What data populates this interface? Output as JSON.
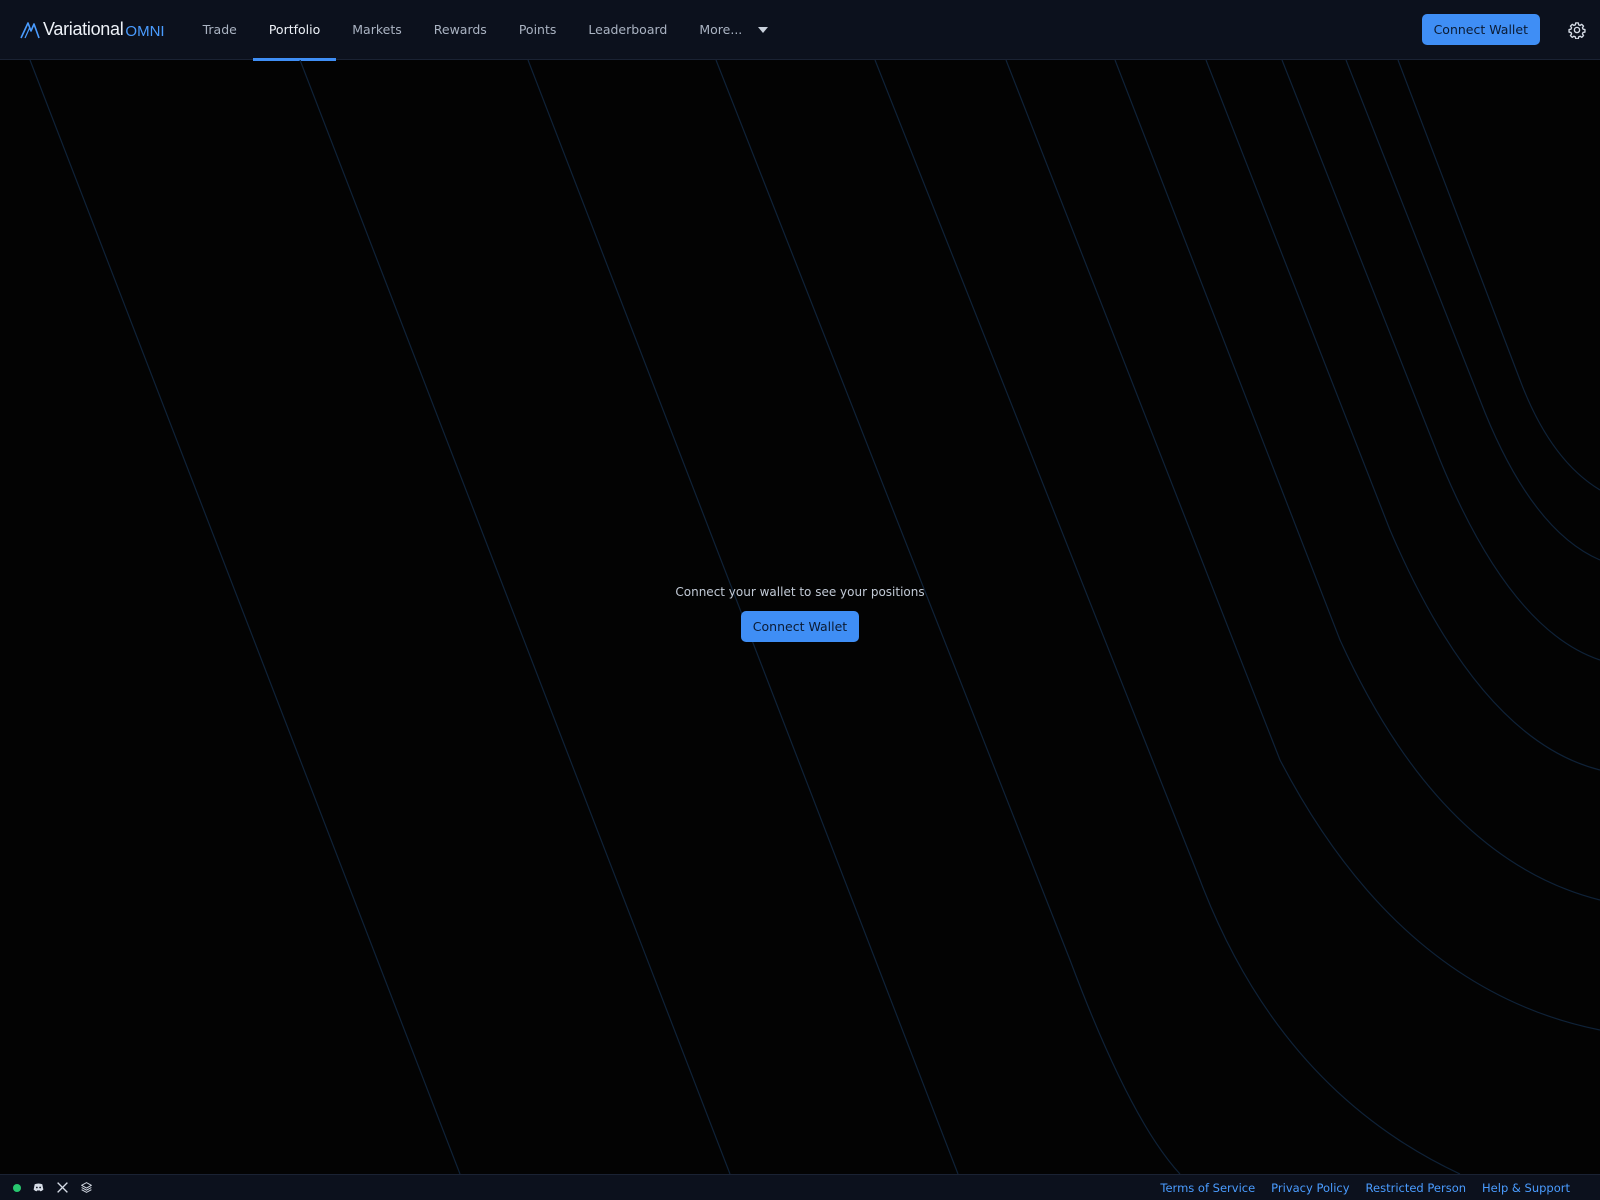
{
  "brand": {
    "name": "Variational",
    "suffix": "OMNI",
    "accent_color": "#3f8ef5",
    "logo_icon": "variational-logo-icon"
  },
  "nav": {
    "items": [
      {
        "label": "Trade",
        "active": false
      },
      {
        "label": "Portfolio",
        "active": true
      },
      {
        "label": "Markets",
        "active": false
      },
      {
        "label": "Rewards",
        "active": false
      },
      {
        "label": "Points",
        "active": false
      },
      {
        "label": "Leaderboard",
        "active": false
      }
    ],
    "more_label": "More...",
    "more_icon": "chevron-down-icon"
  },
  "header": {
    "connect_label": "Connect Wallet",
    "settings_icon": "gear-icon"
  },
  "main": {
    "message": "Connect your wallet to see your positions",
    "connect_label": "Connect Wallet"
  },
  "footer": {
    "status_color": "#28c76f",
    "icons": [
      "status-dot-icon",
      "discord-icon",
      "x-icon",
      "docs-icon"
    ],
    "links": [
      "Terms of Service",
      "Privacy Policy",
      "Restricted Person",
      "Help & Support"
    ]
  }
}
